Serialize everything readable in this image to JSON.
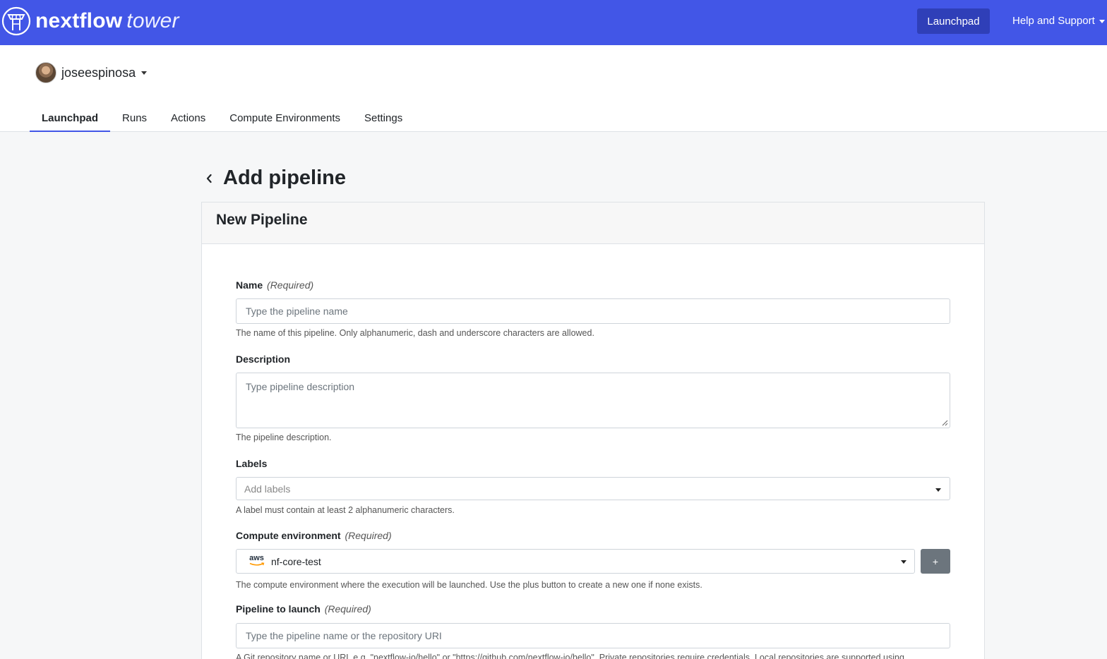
{
  "brand": {
    "name": "nextflow",
    "suffix": "tower"
  },
  "topnav": {
    "launchpad": "Launchpad",
    "help": "Help and Support"
  },
  "user": {
    "name": "joseespinosa"
  },
  "tabs": [
    {
      "label": "Launchpad",
      "active": true
    },
    {
      "label": "Runs"
    },
    {
      "label": "Actions"
    },
    {
      "label": "Compute Environments"
    },
    {
      "label": "Settings"
    }
  ],
  "page": {
    "title": "Add pipeline"
  },
  "card": {
    "title": "New Pipeline"
  },
  "form": {
    "name": {
      "label": "Name",
      "required": "(Required)",
      "placeholder": "Type the pipeline name",
      "help": "The name of this pipeline. Only alphanumeric, dash and underscore characters are allowed."
    },
    "description": {
      "label": "Description",
      "placeholder": "Type pipeline description",
      "help": "The pipeline description."
    },
    "labels": {
      "label": "Labels",
      "placeholder": "Add labels",
      "help": "A label must contain at least 2 alphanumeric characters."
    },
    "compute_env": {
      "label": "Compute environment",
      "required": "(Required)",
      "provider": "aws",
      "value": "nf-core-test",
      "add_button": "+",
      "help": "The compute environment where the execution will be launched. Use the plus button to create a new one if none exists."
    },
    "pipeline": {
      "label": "Pipeline to launch",
      "required": "(Required)",
      "placeholder": "Type the pipeline name or the repository URI",
      "help": "A Git repository name or URL e.g. \"nextflow-io/hello\" or \"https://github.com/nextflow-io/hello\". Private repositories require credentials. Local repositories are supported using"
    }
  },
  "colors": {
    "brand": "#4256e7",
    "brand_dark": "#2f3fb8",
    "secondary": "#6c757d"
  }
}
